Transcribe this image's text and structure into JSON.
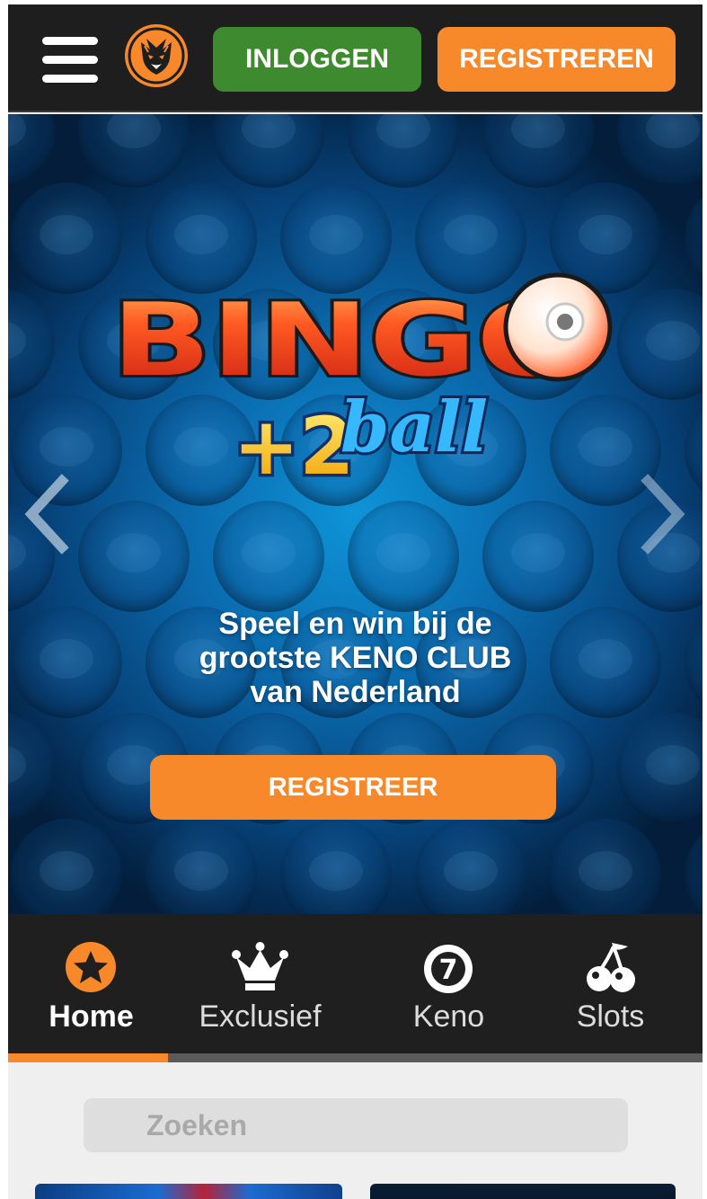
{
  "header": {
    "login_label": "INLOGGEN",
    "register_label": "REGISTREREN",
    "colors": {
      "background": "#1e1e1e",
      "login": "#3d8b2e",
      "register": "#f7892a"
    },
    "icons": {
      "menu": "hamburger-menu-icon",
      "logo": "tiger-logo"
    }
  },
  "hero": {
    "title": "BINGO",
    "subtitle_number": "+2",
    "subtitle_word": "ball",
    "line1": "Speel en win bij de",
    "line2": "grootste KENO CLUB",
    "line3": "van Nederland",
    "cta_label": "REGISTREER",
    "icons": {
      "prev": "chevron-left-icon",
      "next": "chevron-right-icon"
    }
  },
  "categories": {
    "items": [
      {
        "label": "Home",
        "icon": "star-icon",
        "active": true
      },
      {
        "label": "Exclusief",
        "icon": "crown-icon",
        "active": false
      },
      {
        "label": "Keno",
        "icon": "ball-seven-icon",
        "active": false
      },
      {
        "label": "Slots",
        "icon": "cherries-icon",
        "active": false
      }
    ],
    "progress_fraction": 0.23,
    "accent_color": "#f7892a"
  },
  "search": {
    "placeholder": "Zoeken"
  }
}
